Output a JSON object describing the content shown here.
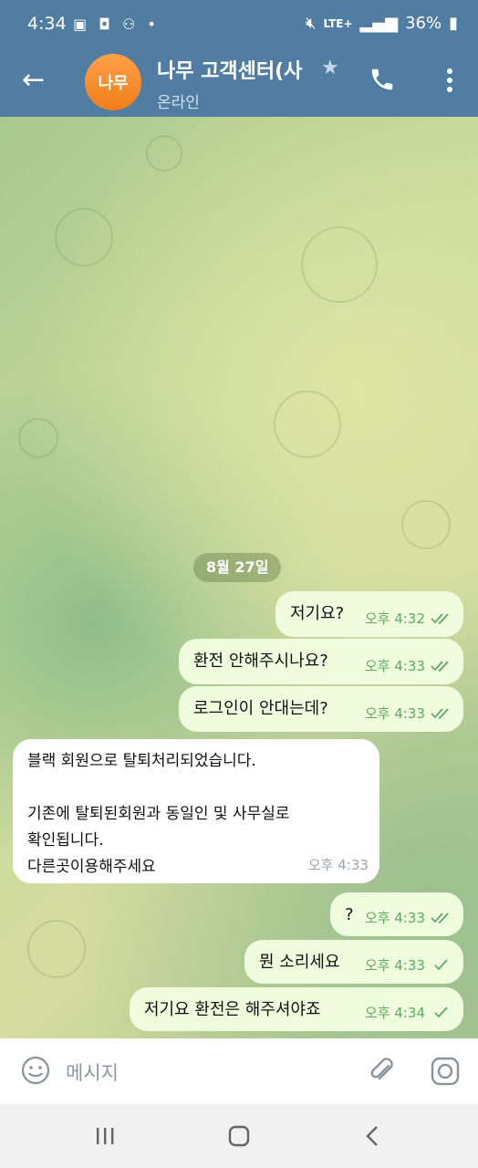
{
  "status_bar": {
    "time": "4:34",
    "network": "LTE+",
    "battery": "36%"
  },
  "header": {
    "avatar_text": "나무",
    "title": "나무 고객센터(사",
    "subtitle": "온라인"
  },
  "chat": {
    "date_label": "8월 27일",
    "messages": [
      {
        "direction": "out",
        "text": "저기요?",
        "time": "오후 4:32",
        "status": "read"
      },
      {
        "direction": "out",
        "text": "환전 안해주시나요?",
        "time": "오후 4:33",
        "status": "read"
      },
      {
        "direction": "out",
        "text": "로그인이 안대는데?",
        "time": "오후 4:33",
        "status": "read"
      },
      {
        "direction": "in",
        "text": "블랙 회원으로 탈퇴처리되었습니다.\n\n기존에 탈퇴된회원과 동일인 및 사무실로\n확인됩니다.\n다른곳이용해주세요",
        "time": "오후 4:33"
      },
      {
        "direction": "out",
        "text": "?",
        "time": "오후 4:33",
        "status": "read"
      },
      {
        "direction": "out",
        "text": "뭔 소리세요",
        "time": "오후 4:33",
        "status": "sent"
      },
      {
        "direction": "out",
        "text": "저기요 환전은 해주셔야죠",
        "time": "오후 4:34",
        "status": "sent"
      }
    ]
  },
  "input": {
    "placeholder": "메시지"
  },
  "colors": {
    "header": "#517da2",
    "outgoing_bubble": "#effdde",
    "incoming_bubble": "#ffffff",
    "tick": "#5fa862",
    "avatar": "#f58a2a"
  }
}
